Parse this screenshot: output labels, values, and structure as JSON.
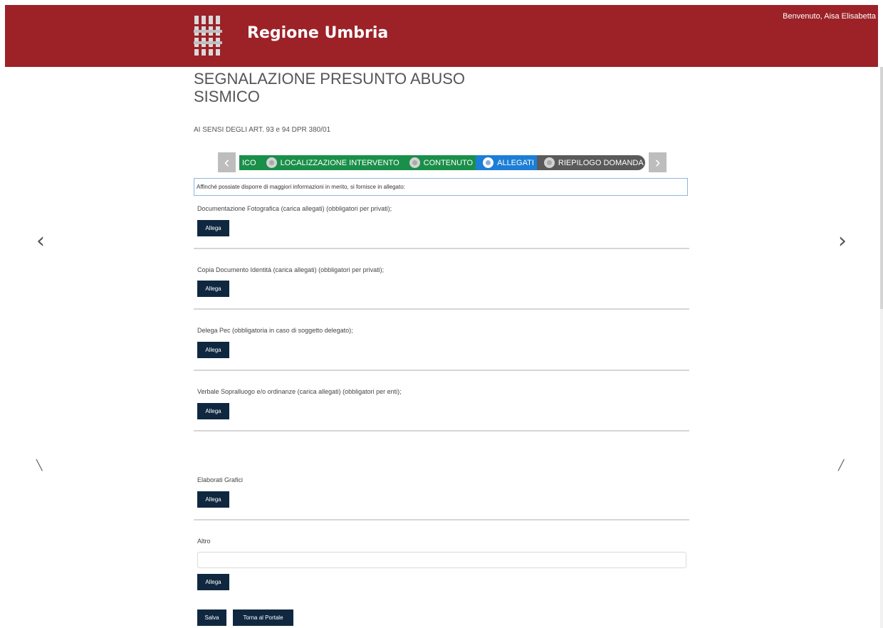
{
  "header": {
    "brand": "Regione Umbria",
    "welcome": "Benvenuto, Aisa Elisabetta",
    "bg_color": "#9c2228"
  },
  "page": {
    "title": "SEGNALAZIONE PRESUNTO ABUSO SISMICO",
    "subtitle": "AI SENSI DEGLI ART. 93 e 94 DPR 380/01"
  },
  "stepper": {
    "steps": [
      {
        "label": "ICO",
        "state": "completed"
      },
      {
        "label": "LOCALIZZAZIONE INTERVENTO",
        "state": "completed"
      },
      {
        "label": "CONTENUTO",
        "state": "completed"
      },
      {
        "label": "ALLEGATI",
        "state": "active"
      },
      {
        "label": "RIEPILOGO DOMANDA",
        "state": "pending"
      }
    ],
    "prev_icon": "chevron-left-icon",
    "next_icon": "chevron-right-icon",
    "colors": {
      "completed": "#1a8f4a",
      "active": "#1c7ed6",
      "pending": "#5a5a5a"
    }
  },
  "info": "Affinché possiate disporre di maggiori informazioni in merito, si fornisce in allegato:",
  "sections": [
    {
      "label": "Documentazione Fotografica (carica allegati) (obbligatori per privati);",
      "button": "Allega"
    },
    {
      "label": "Copia Documento Identitá (carica allegati) (obbligatori per privati);",
      "button": "Allega"
    },
    {
      "label": "Delega Pec (obbligatoria in caso di soggetto delegato);",
      "button": "Allega"
    },
    {
      "label": "Verbale Sopralluogo e/o ordinanze (carica allegati) (obbligatori per enti);",
      "button": "Allega"
    },
    {
      "label": "Elaborati Grafici",
      "button": "Allega"
    },
    {
      "label": "Altro",
      "button": "Allega",
      "input_value": ""
    }
  ],
  "actions": {
    "save": "Salva",
    "back": "Torna al Portale"
  },
  "accent_color": "#0f2840"
}
